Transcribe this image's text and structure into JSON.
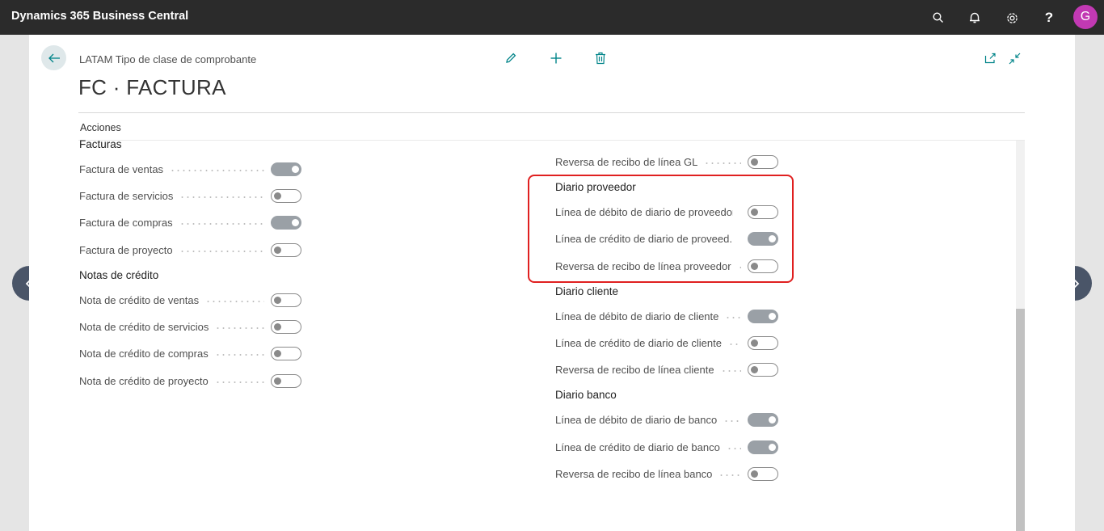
{
  "app": {
    "title": "Dynamics 365 Business Central",
    "avatar_initial": "G",
    "help_glyph": "?"
  },
  "header": {
    "breadcrumb": "LATAM Tipo de clase de comprobante",
    "title": "FC · FACTURA",
    "actions_label": "Acciones"
  },
  "colors": {
    "topbar": "#2b2b2b",
    "avatar": "#c239b3",
    "accent": "#008489",
    "highlight": "#e02020",
    "toggle_on": "#9aa0a6"
  },
  "left_sections": [
    {
      "title": "Facturas",
      "fields": [
        {
          "label": "Factura de ventas",
          "on": true
        },
        {
          "label": "Factura de servicios",
          "on": false
        },
        {
          "label": "Factura de compras",
          "on": true
        },
        {
          "label": "Factura de proyecto",
          "on": false
        }
      ]
    },
    {
      "title": "Notas de crédito",
      "fields": [
        {
          "label": "Nota de crédito de ventas",
          "on": false
        },
        {
          "label": "Nota de crédito de servicios",
          "on": false
        },
        {
          "label": "Nota de crédito de compras",
          "on": false
        },
        {
          "label": "Nota de crédito de proyecto",
          "on": false
        }
      ]
    }
  ],
  "right_top_field": {
    "label": "Reversa de recibo de línea GL",
    "on": false
  },
  "right_sections": [
    {
      "title": "Diario proveedor",
      "fields": [
        {
          "label": "Línea de débito de diario de proveedor",
          "on": false
        },
        {
          "label": "Línea de crédito de diario de proveed...",
          "on": true
        },
        {
          "label": "Reversa de recibo de línea proveedor",
          "on": false
        }
      ]
    },
    {
      "title": "Diario cliente",
      "fields": [
        {
          "label": "Línea de débito de diario de cliente",
          "on": true
        },
        {
          "label": "Línea de crédito de diario de cliente",
          "on": false
        },
        {
          "label": "Reversa de recibo de línea cliente",
          "on": false
        }
      ]
    },
    {
      "title": "Diario banco",
      "fields": [
        {
          "label": "Línea de débito de diario de banco",
          "on": true
        },
        {
          "label": "Línea de crédito de diario de banco",
          "on": true
        },
        {
          "label": "Reversa de recibo de línea banco",
          "on": false
        }
      ]
    }
  ]
}
